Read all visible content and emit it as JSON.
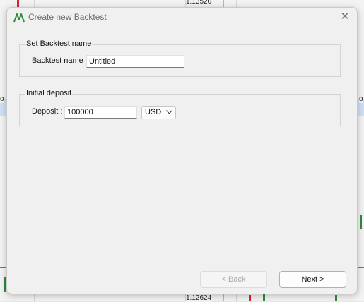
{
  "background": {
    "price_top": "1.13520",
    "price_bottom": "1.12624",
    "marker_left": "o",
    "marker_right": "o"
  },
  "dialog": {
    "title": "Create new Backtest",
    "close_symbol": "✕",
    "name_group": {
      "title": "Set Backtest name",
      "label": "Backtest name :",
      "value": "Untitled"
    },
    "deposit_group": {
      "title": "Initial deposit",
      "label": "Deposit :",
      "value": "100000",
      "currency": "USD"
    },
    "buttons": {
      "back": "< Back",
      "next": "Next >"
    }
  },
  "colors": {
    "accent_green": "#2e8b3a",
    "candle_red": "#d9252b",
    "grid_blue": "#5a6cf0"
  }
}
